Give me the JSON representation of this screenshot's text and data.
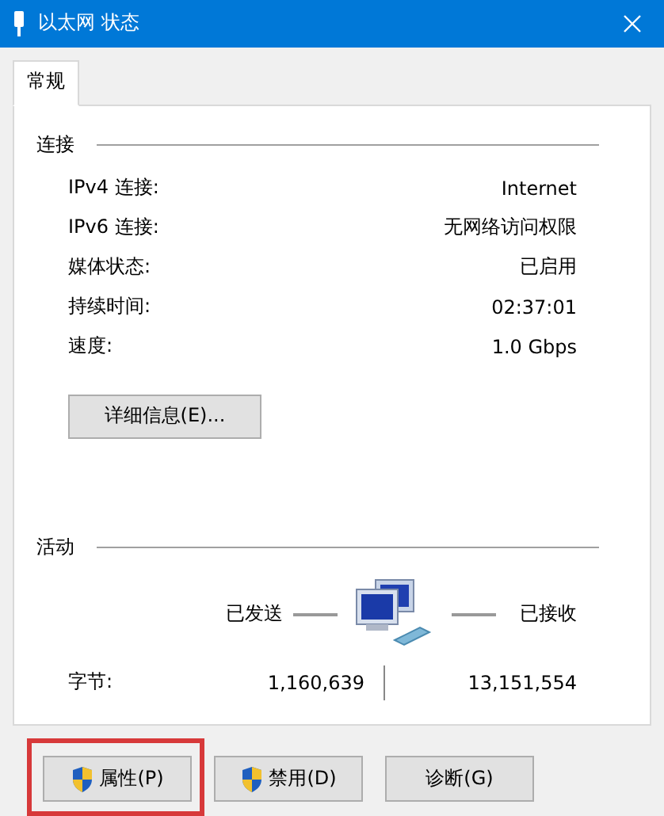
{
  "window": {
    "title": "以太网 状态"
  },
  "tabs": [
    {
      "label": "常规",
      "selected": true
    }
  ],
  "connection": {
    "heading": "连接",
    "rows": [
      {
        "label": "IPv4 连接:",
        "value": "Internet"
      },
      {
        "label": "IPv6 连接:",
        "value": "无网络访问权限"
      },
      {
        "label": "媒体状态:",
        "value": "已启用"
      },
      {
        "label": "持续时间:",
        "value": "02:37:01"
      },
      {
        "label": "速度:",
        "value": "1.0 Gbps"
      }
    ],
    "details_button": "详细信息(E)..."
  },
  "activity": {
    "heading": "活动",
    "sent_label": "已发送",
    "received_label": "已接收",
    "bytes_label": "字节:",
    "bytes_sent": "1,160,639",
    "bytes_received": "13,151,554"
  },
  "buttons": [
    {
      "label": "属性(P)",
      "shield": true,
      "highlighted": true
    },
    {
      "label": "禁用(D)",
      "shield": true,
      "highlighted": false
    },
    {
      "label": "诊断(G)",
      "shield": false,
      "highlighted": false
    }
  ]
}
